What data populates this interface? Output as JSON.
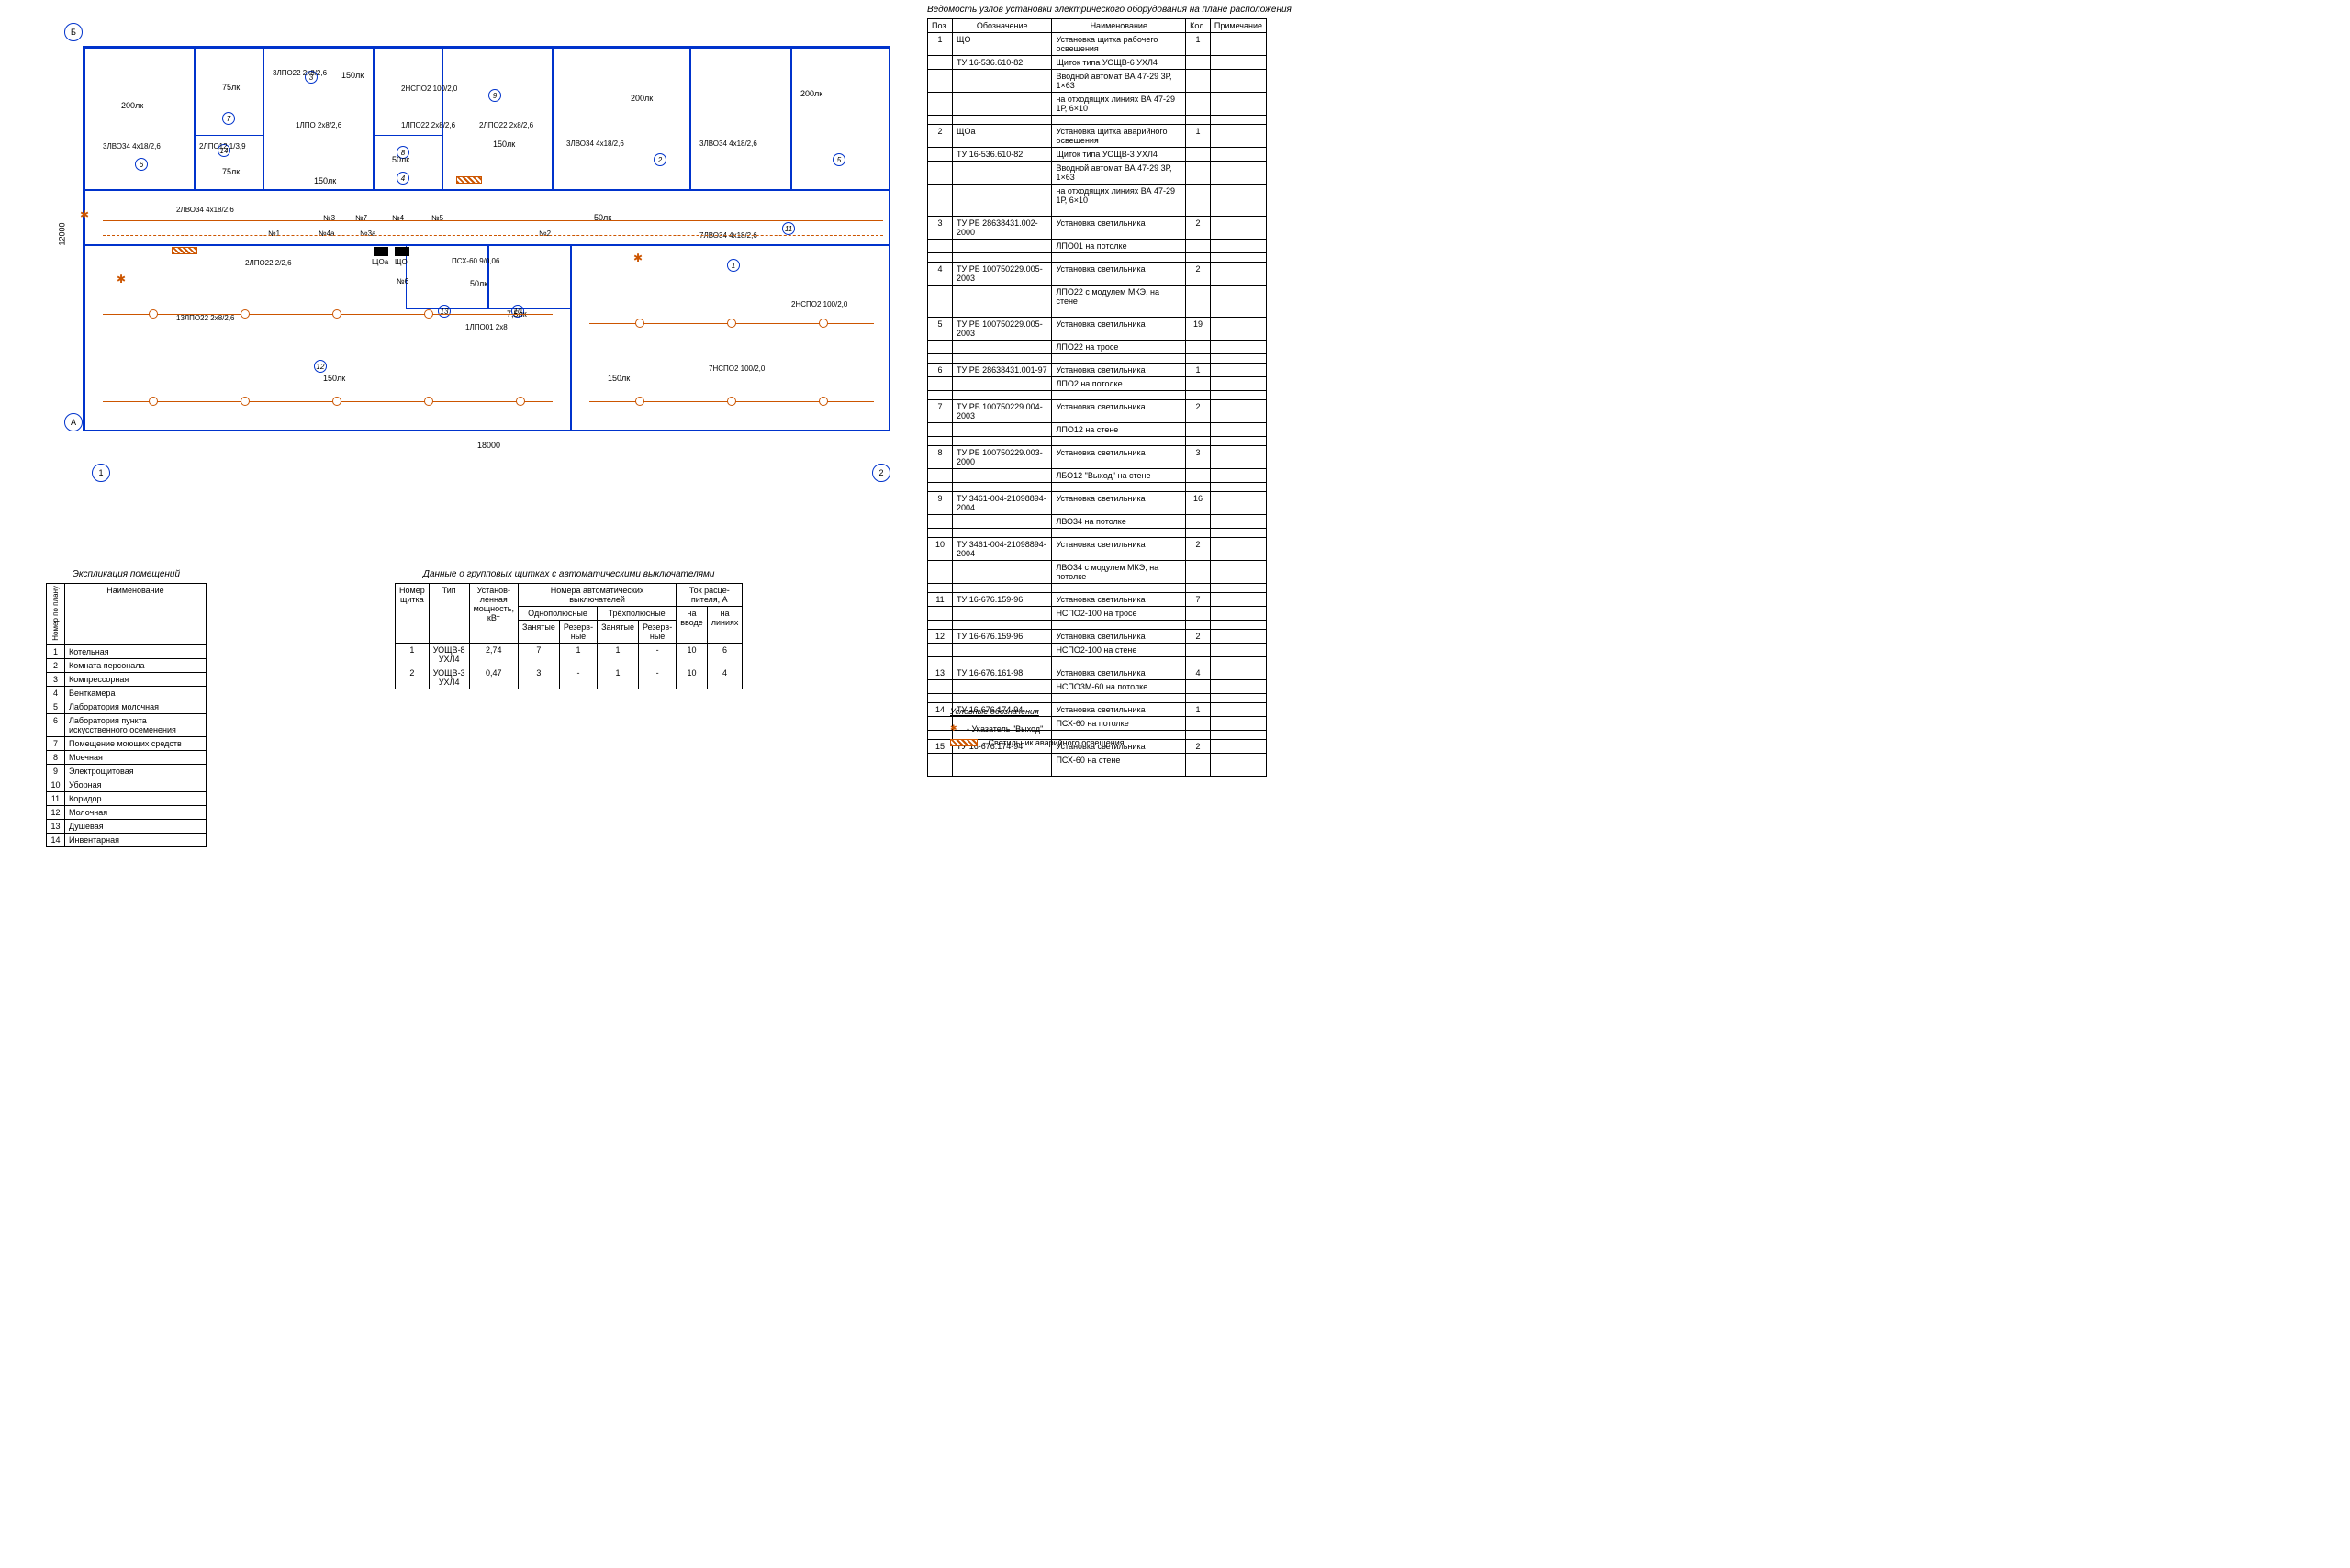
{
  "dimensions": {
    "horizontal": "18000",
    "vertical": "12000"
  },
  "grid_marks": {
    "a": "А",
    "b": "Б",
    "one": "1",
    "two": "2"
  },
  "plan_labels": {
    "lux200_1": "200лк",
    "lux75_1": "75лк",
    "lux75_2": "75лк",
    "lux150_1": "150лк",
    "lux150_2": "150лк",
    "lux150_3": "150лк",
    "lux150_4": "150лк",
    "lux150_5": "150лк",
    "lux50_1": "50лк",
    "lux50_2": "50лк",
    "lux50_3": "50лк",
    "lux200_2": "200лк",
    "lux200_3": "200лк",
    "lux7_5": "7,5лк",
    "f1": "3ЛВО34 4х18/2,6",
    "f2": "2ЛПО12 1/3,9",
    "f3": "3ЛПО22 2х8/2,6",
    "f4": "1ЛПО 2х8/2,6",
    "f5": "2НСПО2 100/2,0",
    "f6": "1ЛПО22 2х8/2,6",
    "f7": "2ЛПО22 2х8/2,6",
    "f8": "3ЛВО34 4х18/2,6",
    "f9": "3ЛВО34 4х18/2,6",
    "f10": "7ЛВО34 4х18/2,6",
    "f11": "2ЛВО34 4х18/2,6",
    "f12": "13ЛПО22 2х8/2,6",
    "f13": "7НСПО2 100/2,0",
    "f14": "2НСПО2 100/2,0",
    "f15": "2ЛПО22 2/2,6",
    "f16": "1ЛПО01 2х8",
    "f17": "ПСХ-60 9/0,06",
    "n1": "№1",
    "n2": "№2",
    "n3": "№3",
    "n3a": "№3a",
    "n4": "№4",
    "n4a": "№4a",
    "n5": "№5",
    "n6": "№6",
    "n7": "№7",
    "sho": "ЩО",
    "shoa": "ЩОа"
  },
  "room_numbers": [
    "1",
    "2",
    "3",
    "4",
    "5",
    "6",
    "7",
    "8",
    "9",
    "10",
    "11",
    "12",
    "13",
    "14"
  ],
  "explication": {
    "title": "Экспликация помещений",
    "header_num": "Номер по плану",
    "header_name": "Наименование",
    "rows": [
      {
        "n": "1",
        "name": "Котельная"
      },
      {
        "n": "2",
        "name": "Комната персонала"
      },
      {
        "n": "3",
        "name": "Компрессорная"
      },
      {
        "n": "4",
        "name": "Венткамера"
      },
      {
        "n": "5",
        "name": "Лаборатория молочная"
      },
      {
        "n": "6",
        "name": "Лаборатория пункта искусственного осеменения"
      },
      {
        "n": "7",
        "name": "Помещение моющих средств"
      },
      {
        "n": "8",
        "name": "Моечная"
      },
      {
        "n": "9",
        "name": "Электрощитовая"
      },
      {
        "n": "10",
        "name": "Уборная"
      },
      {
        "n": "11",
        "name": "Коридор"
      },
      {
        "n": "12",
        "name": "Молочная"
      },
      {
        "n": "13",
        "name": "Душевая"
      },
      {
        "n": "14",
        "name": "Инвентарная"
      }
    ]
  },
  "panel_table": {
    "title": "Данные о групповых щитках с автоматическими выключателями",
    "h_num": "Номер щитка",
    "h_type": "Тип",
    "h_power": "Установ-\nленная\nмощность,\nкВт",
    "h_breakers": "Номера автоматических выключателей",
    "h_single": "Однополюсные",
    "h_triple": "Трёхполюсные",
    "h_occ": "Занятые",
    "h_res": "Резерв-\nные",
    "h_current": "Ток расце-\nпителя, А",
    "h_in": "на вводе",
    "h_lines": "на линиях",
    "rows": [
      {
        "n": "1",
        "type": "УОЩВ-8 УХЛ4",
        "p": "2,74",
        "s_occ": "7",
        "s_res": "1",
        "t_occ": "1",
        "t_res": "-",
        "in": "10",
        "lines": "6"
      },
      {
        "n": "2",
        "type": "УОЩВ-3 УХЛ4",
        "p": "0,47",
        "s_occ": "3",
        "s_res": "-",
        "t_occ": "1",
        "t_res": "-",
        "in": "10",
        "lines": "4"
      }
    ]
  },
  "equipment": {
    "title": "Ведомость узлов установки электрического оборудования на плане расположения",
    "h_pos": "Поз.",
    "h_des": "Обозначение",
    "h_name": "Наименование",
    "h_qty": "Кол.",
    "h_note": "Примечание",
    "rows": [
      {
        "pos": "1",
        "des": "ЩО",
        "name": "Установка щитка рабочего освещения",
        "qty": "1"
      },
      {
        "pos": "",
        "des": "ТУ 16-536.610-82",
        "name": "Щиток типа УОЩВ-6 УХЛ4",
        "qty": ""
      },
      {
        "pos": "",
        "des": "",
        "name": "Вводной автомат ВА 47-29 3Р, 1×63",
        "qty": ""
      },
      {
        "pos": "",
        "des": "",
        "name": "на отходящих линиях ВА 47-29 1Р, 6×10",
        "qty": ""
      },
      {
        "spacer": true
      },
      {
        "pos": "2",
        "des": "ЩОа",
        "name": "Установка щитка аварийного освещения",
        "qty": "1"
      },
      {
        "pos": "",
        "des": "ТУ 16-536.610-82",
        "name": "Щиток типа УОЩВ-3 УХЛ4",
        "qty": ""
      },
      {
        "pos": "",
        "des": "",
        "name": "Вводной автомат ВА 47-29 3Р, 1×63",
        "qty": ""
      },
      {
        "pos": "",
        "des": "",
        "name": "на отходящих линиях ВА 47-29 1Р, 6×10",
        "qty": ""
      },
      {
        "spacer": true
      },
      {
        "pos": "3",
        "des": "ТУ РБ 28638431.002-2000",
        "name": "Установка светильника",
        "qty": "2"
      },
      {
        "pos": "",
        "des": "",
        "name": "ЛПО01 на потолке",
        "qty": ""
      },
      {
        "spacer": true
      },
      {
        "pos": "4",
        "des": "ТУ РБ 100750229.005-2003",
        "name": "Установка светильника",
        "qty": "2"
      },
      {
        "pos": "",
        "des": "",
        "name": "ЛПО22 с модулем МКЭ, на стене",
        "qty": ""
      },
      {
        "spacer": true
      },
      {
        "pos": "5",
        "des": "ТУ РБ 100750229.005-2003",
        "name": "Установка светильника",
        "qty": "19"
      },
      {
        "pos": "",
        "des": "",
        "name": "ЛПО22 на тросе",
        "qty": ""
      },
      {
        "spacer": true
      },
      {
        "pos": "6",
        "des": "ТУ РБ 28638431.001-97",
        "name": "Установка светильника",
        "qty": "1"
      },
      {
        "pos": "",
        "des": "",
        "name": "ЛПО2 на потолке",
        "qty": ""
      },
      {
        "spacer": true
      },
      {
        "pos": "7",
        "des": "ТУ РБ 100750229.004-2003",
        "name": "Установка светильника",
        "qty": "2"
      },
      {
        "pos": "",
        "des": "",
        "name": "ЛПО12 на стене",
        "qty": ""
      },
      {
        "spacer": true
      },
      {
        "pos": "8",
        "des": "ТУ РБ 100750229.003-2000",
        "name": "Установка светильника",
        "qty": "3"
      },
      {
        "pos": "",
        "des": "",
        "name": "ЛБО12 \"Выход\" на стене",
        "qty": ""
      },
      {
        "spacer": true
      },
      {
        "pos": "9",
        "des": "ТУ 3461-004-21098894-2004",
        "name": "Установка светильника",
        "qty": "16"
      },
      {
        "pos": "",
        "des": "",
        "name": "ЛВО34 на потолке",
        "qty": ""
      },
      {
        "spacer": true
      },
      {
        "pos": "10",
        "des": "ТУ 3461-004-21098894-2004",
        "name": "Установка светильника",
        "qty": "2"
      },
      {
        "pos": "",
        "des": "",
        "name": "ЛВО34 с модулем МКЭ, на потолке",
        "qty": ""
      },
      {
        "spacer": true
      },
      {
        "pos": "11",
        "des": "ТУ 16-676.159-96",
        "name": "Установка светильника",
        "qty": "7"
      },
      {
        "pos": "",
        "des": "",
        "name": "НСПО2-100 на тросе",
        "qty": ""
      },
      {
        "spacer": true
      },
      {
        "pos": "12",
        "des": "ТУ 16-676.159-96",
        "name": "Установка светильника",
        "qty": "2"
      },
      {
        "pos": "",
        "des": "",
        "name": "НСПО2-100 на стене",
        "qty": ""
      },
      {
        "spacer": true
      },
      {
        "pos": "13",
        "des": "ТУ 16-676.161-98",
        "name": "Установка светильника",
        "qty": "4"
      },
      {
        "pos": "",
        "des": "",
        "name": "НСПО3М-60 на потолке",
        "qty": ""
      },
      {
        "spacer": true
      },
      {
        "pos": "14",
        "des": "ТУ 16-676.174-94",
        "name": "Установка светильника",
        "qty": "1"
      },
      {
        "pos": "",
        "des": "",
        "name": "ПСХ-60 на потолке",
        "qty": ""
      },
      {
        "spacer": true
      },
      {
        "pos": "15",
        "des": "ТУ 16-676.174-94",
        "name": "Установка светильника",
        "qty": "2"
      },
      {
        "pos": "",
        "des": "",
        "name": "ПСХ-60 на стене",
        "qty": ""
      },
      {
        "spacer": true
      }
    ]
  },
  "legend": {
    "title": "Условные обозначения",
    "exit": "- Указатель \"Выход\"",
    "emerg": "- Светильник аварийного освещения"
  }
}
